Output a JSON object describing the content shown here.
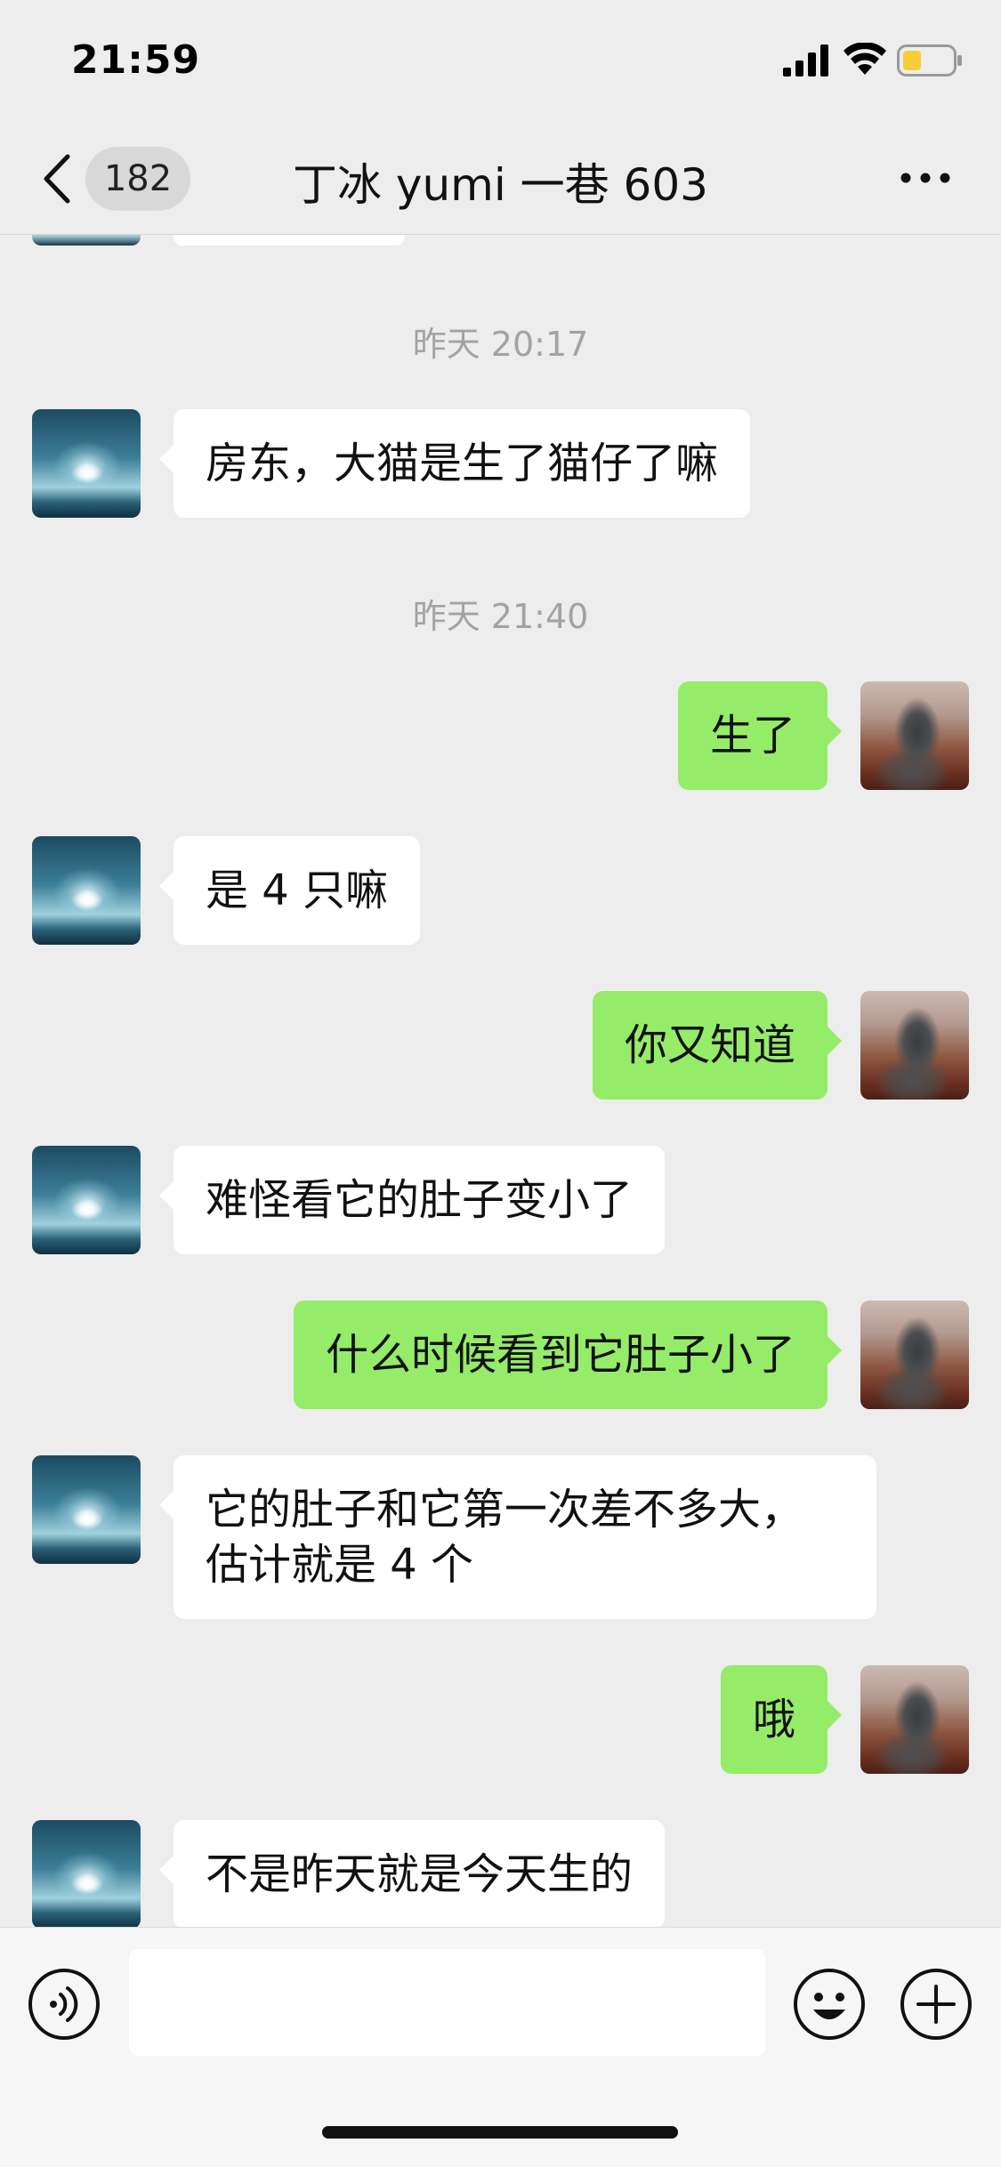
{
  "status_bar": {
    "time": "21:59"
  },
  "nav": {
    "unread_count": "182",
    "title": "丁冰 yumi 一巷 603"
  },
  "messages": [
    {
      "type": "time",
      "text": "昨天 20:17"
    },
    {
      "type": "msg",
      "side": "left",
      "text": "房东，大猫是生了猫仔了嘛"
    },
    {
      "type": "time",
      "text": "昨天 21:40"
    },
    {
      "type": "msg",
      "side": "right",
      "text": "生了"
    },
    {
      "type": "msg",
      "side": "left",
      "text": "是 4 只嘛"
    },
    {
      "type": "msg",
      "side": "right",
      "text": "你又知道"
    },
    {
      "type": "msg",
      "side": "left",
      "text": "难怪看它的肚子变小了"
    },
    {
      "type": "msg",
      "side": "right",
      "text": "什么时候看到它肚子小了"
    },
    {
      "type": "msg",
      "side": "left",
      "line1": "它的肚子和它第一次差不多大，",
      "line2": "估计就是 4 个"
    },
    {
      "type": "msg",
      "side": "right",
      "text": "哦"
    },
    {
      "type": "msg",
      "side": "left",
      "text": "不是昨天就是今天生的"
    }
  ],
  "input": {
    "value": ""
  },
  "colors": {
    "background": "#ededed",
    "outgoing_bubble": "#95ec69",
    "incoming_bubble": "#ffffff",
    "timestamp": "#a3a3a3"
  },
  "icons": [
    "back-icon",
    "more-icon",
    "voice-icon",
    "emoji-icon",
    "plus-icon",
    "signal-icon",
    "wifi-icon",
    "battery-icon"
  ]
}
